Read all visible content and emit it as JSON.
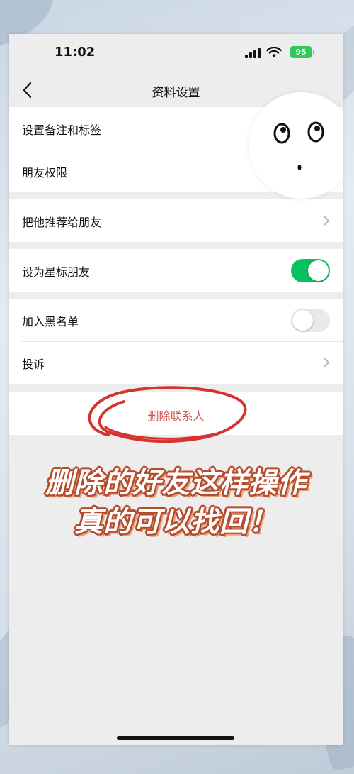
{
  "status_bar": {
    "time": "11:02",
    "battery": "95"
  },
  "navbar": {
    "title": "资料设置"
  },
  "groups": [
    {
      "items": [
        {
          "label": "设置备注和标签"
        },
        {
          "label": "朋友权限"
        }
      ]
    },
    {
      "items": [
        {
          "label": "把他推荐给朋友"
        }
      ]
    },
    {
      "items": [
        {
          "label": "设为星标朋友",
          "toggle": true
        }
      ]
    },
    {
      "items": [
        {
          "label": "加入黑名单",
          "toggle": false
        },
        {
          "label": "投诉"
        }
      ]
    }
  ],
  "delete_contact": {
    "label": "删除联系人"
  },
  "overlay": {
    "line1": "删除的好友这样操作",
    "line2": "真的可以找回！"
  },
  "colors": {
    "accent_green": "#07c160",
    "delete_red": "#d05050",
    "scribble_red": "#d6332c",
    "battery_green": "#34c759"
  }
}
